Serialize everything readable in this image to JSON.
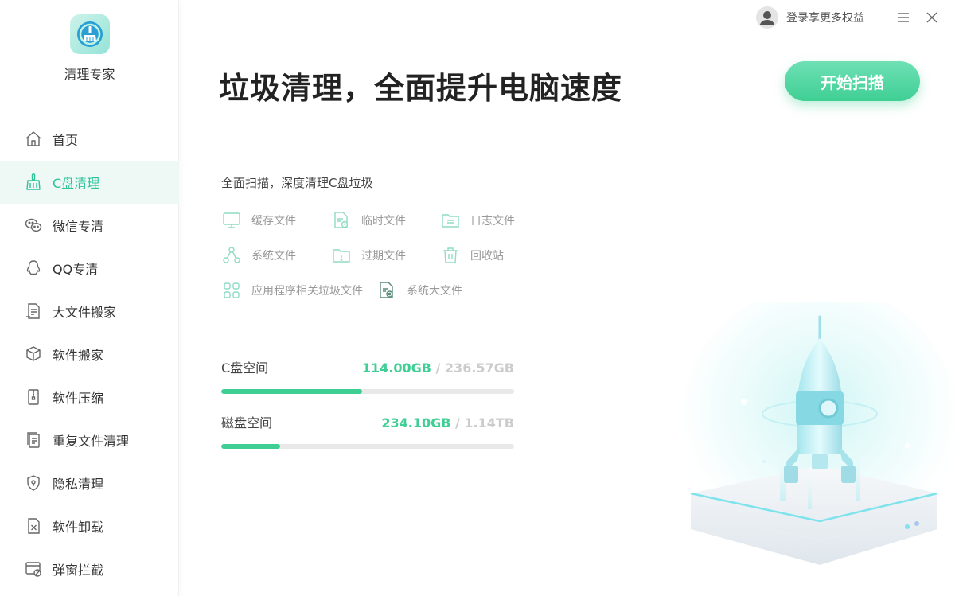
{
  "app": {
    "name": "清理专家",
    "accent": "#3fcf94"
  },
  "topbar": {
    "login_text": "登录享更多权益"
  },
  "sidebar": {
    "items": [
      {
        "label": "首页",
        "icon": "home-icon",
        "active": false
      },
      {
        "label": "C盘清理",
        "icon": "broom-icon",
        "active": true
      },
      {
        "label": "微信专清",
        "icon": "wechat-icon",
        "active": false
      },
      {
        "label": "QQ专清",
        "icon": "qq-icon",
        "active": false
      },
      {
        "label": "大文件搬家",
        "icon": "large-file-icon",
        "active": false
      },
      {
        "label": "软件搬家",
        "icon": "box-move-icon",
        "active": false
      },
      {
        "label": "软件压缩",
        "icon": "zip-icon",
        "active": false
      },
      {
        "label": "重复文件清理",
        "icon": "duplicate-file-icon",
        "active": false
      },
      {
        "label": "隐私清理",
        "icon": "privacy-shield-icon",
        "active": false
      },
      {
        "label": "软件卸载",
        "icon": "uninstall-icon",
        "active": false
      },
      {
        "label": "弹窗拦截",
        "icon": "popup-block-icon",
        "active": false
      }
    ]
  },
  "main": {
    "headline": "垃圾清理，全面提升电脑速度",
    "start_button": "开始扫描",
    "subtitle": "全面扫描，深度清理C盘垃圾",
    "categories": [
      {
        "label": "缓存文件",
        "icon": "monitor-icon"
      },
      {
        "label": "临时文件",
        "icon": "temp-file-icon"
      },
      {
        "label": "日志文件",
        "icon": "folder-icon"
      },
      {
        "label": "系统文件",
        "icon": "network-icon"
      },
      {
        "label": "过期文件",
        "icon": "expired-folder-icon"
      },
      {
        "label": "回收站",
        "icon": "trash-icon"
      },
      {
        "label": "应用程序相关垃圾文件",
        "icon": "apps-grid-icon"
      },
      {
        "label": "系统大文件",
        "icon": "doc-gear-icon"
      }
    ],
    "usage": [
      {
        "label": "C盘空间",
        "used": "114.00GB",
        "sep": " / ",
        "total": "236.57GB",
        "fraction": 0.48
      },
      {
        "label": "磁盘空间",
        "used": "234.10GB",
        "sep": " / ",
        "total": "1.14TB",
        "fraction": 0.2
      }
    ]
  }
}
